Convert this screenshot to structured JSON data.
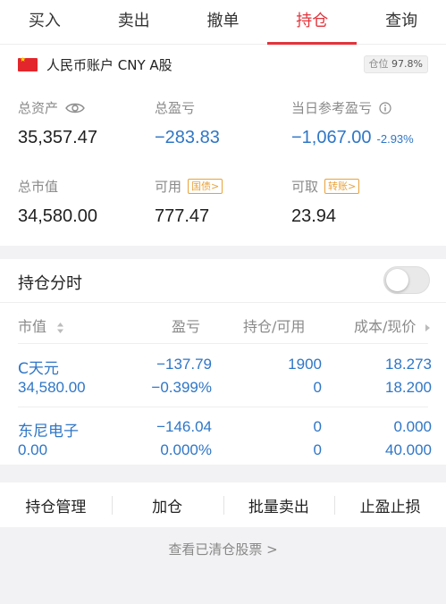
{
  "tabs": [
    {
      "label": "买入",
      "active": false
    },
    {
      "label": "卖出",
      "active": false
    },
    {
      "label": "撤单",
      "active": false
    },
    {
      "label": "持仓",
      "active": true
    },
    {
      "label": "查询",
      "active": false
    }
  ],
  "account": {
    "name": "人民币账户 CNY A股",
    "position_label": "仓位",
    "position_value": "97.8%"
  },
  "metrics": {
    "total_assets": {
      "label": "总资产",
      "value": "35,357.47"
    },
    "total_pnl": {
      "label": "总盈亏",
      "value": "−283.83"
    },
    "today_pnl": {
      "label": "当日参考盈亏",
      "value": "−1,067.00",
      "pct": "-2.93%"
    },
    "market_value": {
      "label": "总市值",
      "value": "34,580.00"
    },
    "available": {
      "label": "可用",
      "value": "777.47",
      "tag": "国债>"
    },
    "withdrawable": {
      "label": "可取",
      "value": "23.94",
      "tag": "转账>"
    }
  },
  "holdings": {
    "title": "持仓分时",
    "columns": [
      "市值",
      "盈亏",
      "持仓/可用",
      "成本/现价"
    ],
    "rows": [
      {
        "name": "C天元",
        "market_value": "34,580.00",
        "pnl": "−137.79",
        "pnl_pct": "−0.399%",
        "hold": "1900",
        "avail": "0",
        "cost": "18.273",
        "price": "18.200"
      },
      {
        "name": "东尼电子",
        "market_value": "0.00",
        "pnl": "−146.04",
        "pnl_pct": "0.000%",
        "hold": "0",
        "avail": "0",
        "cost": "0.000",
        "price": "40.000"
      }
    ]
  },
  "actions": [
    "持仓管理",
    "加仓",
    "批量卖出",
    "止盈止损"
  ],
  "cleared_link": "查看已清仓股票 >",
  "colors": {
    "accent": "#e2343b",
    "down": "#2f76c6",
    "tag": "#e8a23a"
  }
}
